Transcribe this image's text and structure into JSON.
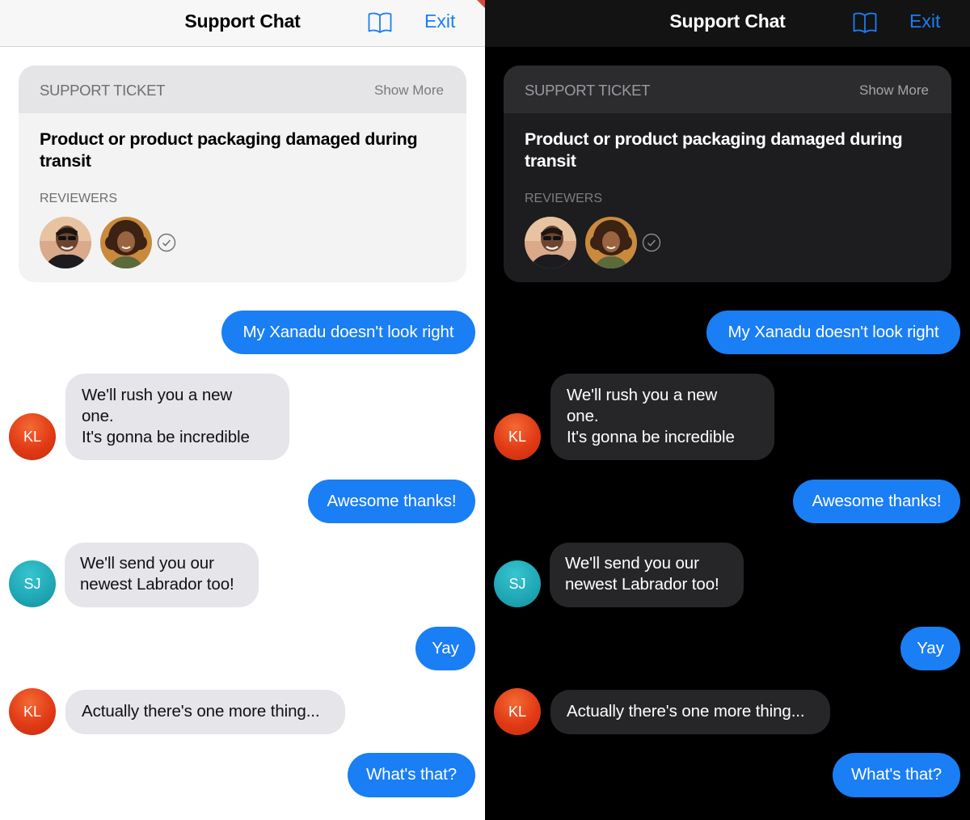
{
  "header": {
    "title": "Support Chat",
    "exit_label": "Exit",
    "book_icon": "book-icon"
  },
  "ticket": {
    "label": "SUPPORT TICKET",
    "show_more": "Show More",
    "title": "Product or product packaging damaged during transit",
    "reviewers_label": "REVIEWERS",
    "reviewer_check_icon": "check-circle-icon"
  },
  "messages": [
    {
      "from": "me",
      "text": "My Xanadu doesn't look right"
    },
    {
      "from": "KL",
      "text": "We'll rush you a new\none.\nIt's gonna be incredible"
    },
    {
      "from": "me",
      "text": "Awesome thanks!"
    },
    {
      "from": "SJ",
      "text": "We'll send you our\nnewest Labrador too!"
    },
    {
      "from": "me",
      "text": "Yay"
    },
    {
      "from": "KL",
      "text": "Actually there's one more thing..."
    },
    {
      "from": "me",
      "text": "What's that?"
    }
  ],
  "colors": {
    "accent": "#1a7ef5",
    "kl_avatar": "#e13a15",
    "sj_avatar": "#1fa6b4"
  },
  "themes": [
    "light",
    "dark"
  ]
}
